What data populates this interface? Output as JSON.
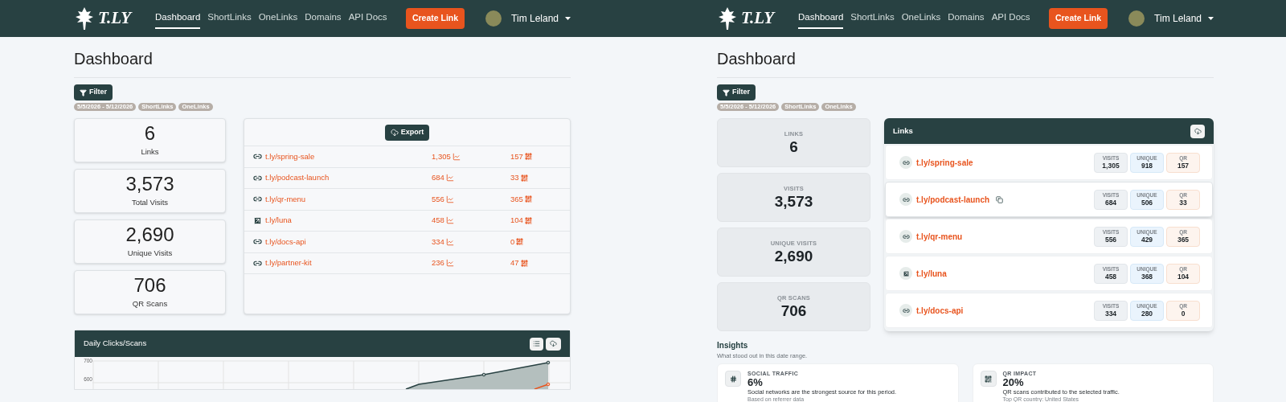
{
  "panels": [
    {
      "nav": {
        "logo": "T.LY",
        "items": [
          {
            "label": "Dashboard",
            "selected": true
          },
          {
            "label": "ShortLinks",
            "selected": false
          },
          {
            "label": "OneLinks",
            "selected": false
          },
          {
            "label": "Domains",
            "selected": false
          },
          {
            "label": "API Docs",
            "selected": false
          }
        ],
        "create": "Create Link",
        "user": "Tim Leland"
      },
      "title": "Dashboard",
      "filter": "Filter",
      "chips": [
        "5/5/2026 - 5/12/2026",
        "ShortLinks",
        "OneLinks"
      ],
      "stats": [
        {
          "value": "6",
          "label": "Links"
        },
        {
          "value": "3,573",
          "label": "Total Visits"
        },
        {
          "value": "2,690",
          "label": "Unique Visits"
        },
        {
          "value": "706",
          "label": "QR Scans"
        }
      ],
      "export": "Export",
      "links": [
        {
          "kind": "shortlink",
          "url": "t.ly/spring-sale",
          "visits": "1,305",
          "scans": "157"
        },
        {
          "kind": "shortlink",
          "url": "t.ly/podcast-launch",
          "visits": "684",
          "scans": "33"
        },
        {
          "kind": "shortlink",
          "url": "t.ly/qr-menu",
          "visits": "556",
          "scans": "365"
        },
        {
          "kind": "onelink",
          "url": "t.ly/luna",
          "visits": "458",
          "scans": "104"
        },
        {
          "kind": "shortlink",
          "url": "t.ly/docs-api",
          "visits": "334",
          "scans": "0"
        },
        {
          "kind": "shortlink",
          "url": "t.ly/partner-kit",
          "visits": "236",
          "scans": "47"
        }
      ],
      "chart": {
        "title": "Daily Clicks/Scans",
        "y_tick_labels": [
          "700",
          "600"
        ]
      }
    },
    {
      "nav": {
        "logo": "T.LY",
        "items": [
          {
            "label": "Dashboard",
            "selected": true
          },
          {
            "label": "ShortLinks",
            "selected": false
          },
          {
            "label": "OneLinks",
            "selected": false
          },
          {
            "label": "Domains",
            "selected": false
          },
          {
            "label": "API Docs",
            "selected": false
          }
        ],
        "create": "Create Link",
        "user": "Tim Leland"
      },
      "title": "Dashboard",
      "filter": "Filter",
      "chips": [
        "5/5/2026 - 5/12/2026",
        "ShortLinks",
        "OneLinks"
      ],
      "stats": [
        {
          "label": "LINKS",
          "value": "6"
        },
        {
          "label": "VISITS",
          "value": "3,573"
        },
        {
          "label": "UNIQUE VISITS",
          "value": "2,690"
        },
        {
          "label": "QR SCANS",
          "value": "706"
        }
      ],
      "links_panel": {
        "title": "Links",
        "rows": [
          {
            "kind": "shortlink",
            "url": "t.ly/spring-sale",
            "hovered": false,
            "metrics": [
              {
                "label": "VISITS",
                "value": "1,305"
              },
              {
                "label": "UNIQUE",
                "value": "918"
              },
              {
                "label": "QR",
                "value": "157"
              }
            ]
          },
          {
            "kind": "shortlink",
            "url": "t.ly/podcast-launch",
            "hovered": true,
            "metrics": [
              {
                "label": "VISITS",
                "value": "684"
              },
              {
                "label": "UNIQUE",
                "value": "506"
              },
              {
                "label": "QR",
                "value": "33"
              }
            ]
          },
          {
            "kind": "shortlink",
            "url": "t.ly/qr-menu",
            "hovered": false,
            "metrics": [
              {
                "label": "VISITS",
                "value": "556"
              },
              {
                "label": "UNIQUE",
                "value": "429"
              },
              {
                "label": "QR",
                "value": "365"
              }
            ]
          },
          {
            "kind": "onelink",
            "url": "t.ly/luna",
            "hovered": false,
            "metrics": [
              {
                "label": "VISITS",
                "value": "458"
              },
              {
                "label": "UNIQUE",
                "value": "368"
              },
              {
                "label": "QR",
                "value": "104"
              }
            ]
          },
          {
            "kind": "shortlink",
            "url": "t.ly/docs-api",
            "hovered": false,
            "metrics": [
              {
                "label": "VISITS",
                "value": "334"
              },
              {
                "label": "UNIQUE",
                "value": "280"
              },
              {
                "label": "QR",
                "value": "0"
              }
            ]
          }
        ]
      },
      "insights": {
        "title": "Insights",
        "subtitle": "What stood out in this date range.",
        "cards": [
          {
            "kind": "social",
            "label": "SOCIAL TRAFFIC",
            "value": "6%",
            "text": "Social networks are the strongest source for this period.",
            "note": "Based on referrer data"
          },
          {
            "kind": "qr",
            "label": "QR IMPACT",
            "value": "20%",
            "text": "QR scans contributed to the selected traffic.",
            "note": "Top QR country: United States"
          }
        ]
      }
    }
  ]
}
